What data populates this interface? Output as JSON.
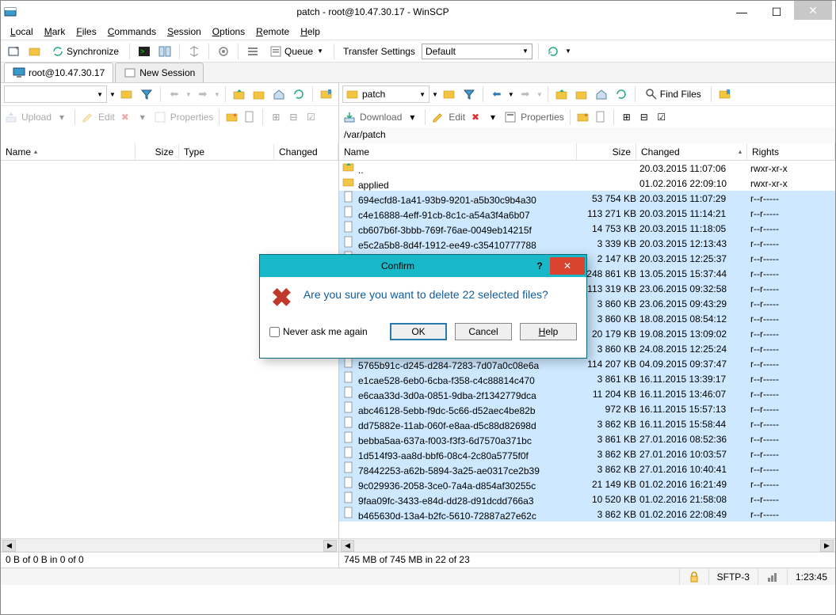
{
  "window": {
    "title": "patch - root@10.47.30.17 - WinSCP"
  },
  "menu": {
    "local": "Local",
    "mark": "Mark",
    "files": "Files",
    "commands": "Commands",
    "session": "Session",
    "options": "Options",
    "remote": "Remote",
    "help": "Help"
  },
  "toolbar": {
    "synchronize": "Synchronize",
    "queue": "Queue",
    "transfer_label": "Transfer Settings",
    "transfer_value": "Default"
  },
  "tabs": {
    "session": "root@10.47.30.17",
    "new": "New Session"
  },
  "nav": {
    "left_path": "",
    "right_path": "patch",
    "find_files": "Find Files"
  },
  "actions": {
    "upload": "Upload",
    "download": "Download",
    "edit": "Edit",
    "properties": "Properties"
  },
  "pathbar": {
    "right": "/var/patch"
  },
  "columns": {
    "name": "Name",
    "size": "Size",
    "type": "Type",
    "changed": "Changed",
    "rights": "Rights"
  },
  "files": [
    {
      "name": "..",
      "size": "",
      "changed": "20.03.2015 11:07:06",
      "rights": "rwxr-xr-x",
      "dir": true,
      "up": true
    },
    {
      "name": "applied",
      "size": "",
      "changed": "01.02.2016 22:09:10",
      "rights": "rwxr-xr-x",
      "dir": true
    },
    {
      "name": "694ecfd8-1a41-93b9-9201-a5b30c9b4a30",
      "size": "53 754 KB",
      "changed": "20.03.2015 11:07:29",
      "rights": "r--r-----"
    },
    {
      "name": "c4e16888-4eff-91cb-8c1c-a54a3f4a6b07",
      "size": "113 271 KB",
      "changed": "20.03.2015 11:14:21",
      "rights": "r--r-----"
    },
    {
      "name": "cb607b6f-3bbb-769f-76ae-0049eb14215f",
      "size": "14 753 KB",
      "changed": "20.03.2015 11:18:05",
      "rights": "r--r-----"
    },
    {
      "name": "e5c2a5b8-8d4f-1912-ee49-c35410777788",
      "size": "3 339 KB",
      "changed": "20.03.2015 12:13:43",
      "rights": "r--r-----"
    },
    {
      "name": "",
      "size": "2 147 KB",
      "changed": "20.03.2015 12:25:37",
      "rights": "r--r-----",
      "hidden": true
    },
    {
      "name": "",
      "size": "248 861 KB",
      "changed": "13.05.2015 15:37:44",
      "rights": "r--r-----",
      "hidden": true
    },
    {
      "name": "",
      "size": "113 319 KB",
      "changed": "23.06.2015 09:32:58",
      "rights": "r--r-----",
      "hidden": true
    },
    {
      "name": "",
      "size": "3 860 KB",
      "changed": "23.06.2015 09:43:29",
      "rights": "r--r-----",
      "hidden": true
    },
    {
      "name": "",
      "size": "3 860 KB",
      "changed": "18.08.2015 08:54:12",
      "rights": "r--r-----",
      "hidden": true
    },
    {
      "name": "",
      "size": "20 179 KB",
      "changed": "19.08.2015 13:09:02",
      "rights": "r--r-----",
      "hidden": true
    },
    {
      "name": "",
      "size": "3 860 KB",
      "changed": "24.08.2015 12:25:24",
      "rights": "r--r-----",
      "hidden": true
    },
    {
      "name": "5765b91c-d245-d284-7283-7d07a0c08e6a",
      "size": "114 207 KB",
      "changed": "04.09.2015 09:37:47",
      "rights": "r--r-----"
    },
    {
      "name": "e1cae528-6eb0-6cba-f358-c4c88814c470",
      "size": "3 861 KB",
      "changed": "16.11.2015 13:39:17",
      "rights": "r--r-----"
    },
    {
      "name": "e6caa33d-3d0a-0851-9dba-2f1342779dca",
      "size": "11 204 KB",
      "changed": "16.11.2015 13:46:07",
      "rights": "r--r-----"
    },
    {
      "name": "abc46128-5ebb-f9dc-5c66-d52aec4be82b",
      "size": "972 KB",
      "changed": "16.11.2015 15:57:13",
      "rights": "r--r-----"
    },
    {
      "name": "dd75882e-11ab-060f-e8aa-d5c88d82698d",
      "size": "3 862 KB",
      "changed": "16.11.2015 15:58:44",
      "rights": "r--r-----"
    },
    {
      "name": "bebba5aa-637a-f003-f3f3-6d7570a371bc",
      "size": "3 861 KB",
      "changed": "27.01.2016 08:52:36",
      "rights": "r--r-----"
    },
    {
      "name": "1d514f93-aa8d-bbf6-08c4-2c80a5775f0f",
      "size": "3 862 KB",
      "changed": "27.01.2016 10:03:57",
      "rights": "r--r-----"
    },
    {
      "name": "78442253-a62b-5894-3a25-ae0317ce2b39",
      "size": "3 862 KB",
      "changed": "27.01.2016 10:40:41",
      "rights": "r--r-----"
    },
    {
      "name": "9c029936-2058-3ce0-7a4a-d854af30255c",
      "size": "21 149 KB",
      "changed": "01.02.2016 16:21:49",
      "rights": "r--r-----"
    },
    {
      "name": "9faa09fc-3433-e84d-dd28-d91dcdd766a3",
      "size": "10 520 KB",
      "changed": "01.02.2016 21:58:08",
      "rights": "r--r-----"
    },
    {
      "name": "b465630d-13a4-b2fc-5610-72887a27e62c",
      "size": "3 862 KB",
      "changed": "01.02.2016 22:08:49",
      "rights": "r--r-----"
    }
  ],
  "status": {
    "left": "0 B of 0 B in 0 of 0",
    "right": "745 MB of 745 MB in 22 of 23",
    "protocol": "SFTP-3",
    "time": "1:23:45"
  },
  "dialog": {
    "title": "Confirm",
    "message": "Are you sure you want to delete 22 selected files?",
    "never": "Never ask me again",
    "ok": "OK",
    "cancel": "Cancel",
    "help": "Help"
  }
}
